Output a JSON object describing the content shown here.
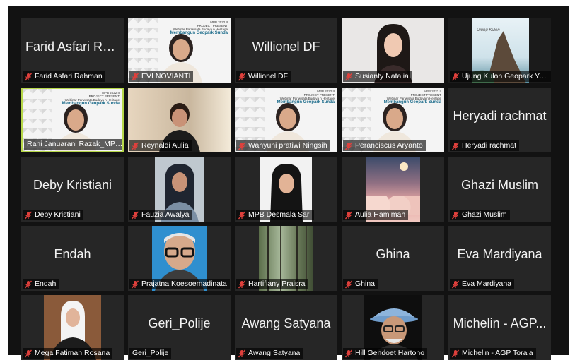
{
  "participants": [
    {
      "name": "Farid Asfari Rahman",
      "display": "Farid Asfari Rah...",
      "type": "name",
      "muted": true
    },
    {
      "name": "EVI NOVIANTI",
      "type": "video",
      "muted": true,
      "scene": "slide"
    },
    {
      "name": "Willionel DF",
      "display": "Willionel DF",
      "type": "name",
      "muted": true
    },
    {
      "name": "Susianty Natalia",
      "type": "video",
      "muted": true,
      "scene": "room"
    },
    {
      "name": "Ujung Kulon Geopark Yo...",
      "type": "video",
      "muted": true,
      "scene": "rock"
    },
    {
      "name": "Rani Januarani Razak_MPB...",
      "type": "video",
      "muted": false,
      "scene": "slide",
      "active": true
    },
    {
      "name": "Reynaldi Aulia",
      "type": "video",
      "muted": true,
      "scene": "home"
    },
    {
      "name": "Wahyuni pratiwi Ningsih",
      "type": "video",
      "muted": true,
      "scene": "slide"
    },
    {
      "name": "Peranciscus Aryanto",
      "type": "video",
      "muted": true,
      "scene": "slide"
    },
    {
      "name": "Heryadi rachmat",
      "display": "Heryadi rachmat",
      "type": "name",
      "muted": true
    },
    {
      "name": "Deby Kristiani",
      "display": "Deby Kristiani",
      "type": "name",
      "muted": true
    },
    {
      "name": "Fauzia Awalya",
      "type": "video",
      "muted": true,
      "scene": "portrait"
    },
    {
      "name": "MPB Desmala Sari",
      "type": "video",
      "muted": true,
      "scene": "portrait2"
    },
    {
      "name": "Aulia Hamimah",
      "type": "video",
      "muted": true,
      "scene": "sky"
    },
    {
      "name": "Ghazi Muslim",
      "display": "Ghazi Muslim",
      "type": "name",
      "muted": true
    },
    {
      "name": "Endah",
      "display": "Endah",
      "type": "name",
      "muted": true
    },
    {
      "name": "Prajatna Koesoemadinata",
      "type": "video",
      "muted": true,
      "scene": "elder"
    },
    {
      "name": "Hartifiany Praisra",
      "type": "video",
      "muted": true,
      "scene": "forest"
    },
    {
      "name": "Ghina",
      "display": "Ghina",
      "type": "name",
      "muted": true
    },
    {
      "name": "Eva Mardiyana",
      "display": "Eva Mardiyana",
      "type": "name",
      "muted": true
    },
    {
      "name": "Mega Fatimah Rosana",
      "type": "video",
      "muted": true,
      "scene": "hijab"
    },
    {
      "name": "Geri_Polije",
      "display": "Geri_Polije",
      "type": "name",
      "muted": false
    },
    {
      "name": "Awang Satyana",
      "display": "Awang Satyana",
      "type": "name",
      "muted": true
    },
    {
      "name": "Hill Gendoet Hartono",
      "type": "video",
      "muted": true,
      "scene": "hat"
    },
    {
      "name": "Michelin - AGP Toraja",
      "display": "Michelin - AGP...",
      "type": "name",
      "muted": true
    }
  ],
  "slide_text": {
    "event": "MPB 2022 II",
    "project": "PROJECT PRESENT",
    "subtitle": "Webinar Pariwisata Budaya n Heritage",
    "title": "Membangun Geopark Sunda"
  },
  "rock_caption": "Ujung Kulon",
  "colors": {
    "active_border": "#b7d84a",
    "mute_icon": "#e0403c",
    "tile_bg": "#262626"
  }
}
